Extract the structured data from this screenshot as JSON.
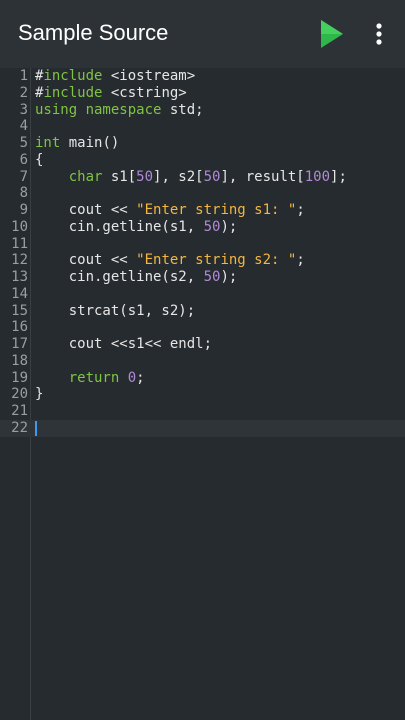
{
  "appbar": {
    "title": "Sample Source",
    "run_icon": "play-icon",
    "menu_icon": "more-vert-icon"
  },
  "colors": {
    "keyword": "#7fc443",
    "number": "#b08ad6",
    "string": "#f4b63f",
    "text": "#e6e6e6",
    "run": "#2fb84a"
  },
  "editor": {
    "lines": [
      {
        "n": "1",
        "tokens": [
          {
            "t": "p",
            "v": "#"
          },
          {
            "t": "kw",
            "v": "include"
          },
          {
            "t": "p",
            "v": " <iostream>"
          }
        ]
      },
      {
        "n": "2",
        "tokens": [
          {
            "t": "p",
            "v": "#"
          },
          {
            "t": "kw",
            "v": "include"
          },
          {
            "t": "p",
            "v": " <cstring>"
          }
        ]
      },
      {
        "n": "3",
        "tokens": [
          {
            "t": "kw",
            "v": "using namespace"
          },
          {
            "t": "p",
            "v": " std;"
          }
        ]
      },
      {
        "n": "4",
        "tokens": []
      },
      {
        "n": "5",
        "tokens": [
          {
            "t": "kw",
            "v": "int"
          },
          {
            "t": "p",
            "v": " main()"
          }
        ]
      },
      {
        "n": "6",
        "tokens": [
          {
            "t": "p",
            "v": "{"
          }
        ]
      },
      {
        "n": "7",
        "tokens": [
          {
            "t": "p",
            "v": "    "
          },
          {
            "t": "kw",
            "v": "char"
          },
          {
            "t": "p",
            "v": " s1["
          },
          {
            "t": "num",
            "v": "50"
          },
          {
            "t": "p",
            "v": "], s2["
          },
          {
            "t": "num",
            "v": "50"
          },
          {
            "t": "p",
            "v": "], result["
          },
          {
            "t": "num",
            "v": "100"
          },
          {
            "t": "p",
            "v": "];"
          }
        ]
      },
      {
        "n": "8",
        "tokens": []
      },
      {
        "n": "9",
        "tokens": [
          {
            "t": "p",
            "v": "    cout << "
          },
          {
            "t": "str",
            "v": "\"Enter string s1: \""
          },
          {
            "t": "p",
            "v": ";"
          }
        ]
      },
      {
        "n": "10",
        "tokens": [
          {
            "t": "p",
            "v": "    cin.getline(s1, "
          },
          {
            "t": "num",
            "v": "50"
          },
          {
            "t": "p",
            "v": ");"
          }
        ]
      },
      {
        "n": "11",
        "tokens": []
      },
      {
        "n": "12",
        "tokens": [
          {
            "t": "p",
            "v": "    cout << "
          },
          {
            "t": "str",
            "v": "\"Enter string s2: \""
          },
          {
            "t": "p",
            "v": ";"
          }
        ]
      },
      {
        "n": "13",
        "tokens": [
          {
            "t": "p",
            "v": "    cin.getline(s2, "
          },
          {
            "t": "num",
            "v": "50"
          },
          {
            "t": "p",
            "v": ");"
          }
        ]
      },
      {
        "n": "14",
        "tokens": []
      },
      {
        "n": "15",
        "tokens": [
          {
            "t": "p",
            "v": "    strcat(s1, s2);"
          }
        ]
      },
      {
        "n": "16",
        "tokens": []
      },
      {
        "n": "17",
        "tokens": [
          {
            "t": "p",
            "v": "    cout <<s1<< endl;"
          }
        ]
      },
      {
        "n": "18",
        "tokens": []
      },
      {
        "n": "19",
        "tokens": [
          {
            "t": "p",
            "v": "    "
          },
          {
            "t": "kw",
            "v": "return"
          },
          {
            "t": "p",
            "v": " "
          },
          {
            "t": "num",
            "v": "0"
          },
          {
            "t": "p",
            "v": ";"
          }
        ]
      },
      {
        "n": "20",
        "tokens": [
          {
            "t": "p",
            "v": "}"
          }
        ]
      },
      {
        "n": "21",
        "tokens": []
      },
      {
        "n": "22",
        "tokens": [],
        "active": true
      }
    ]
  }
}
